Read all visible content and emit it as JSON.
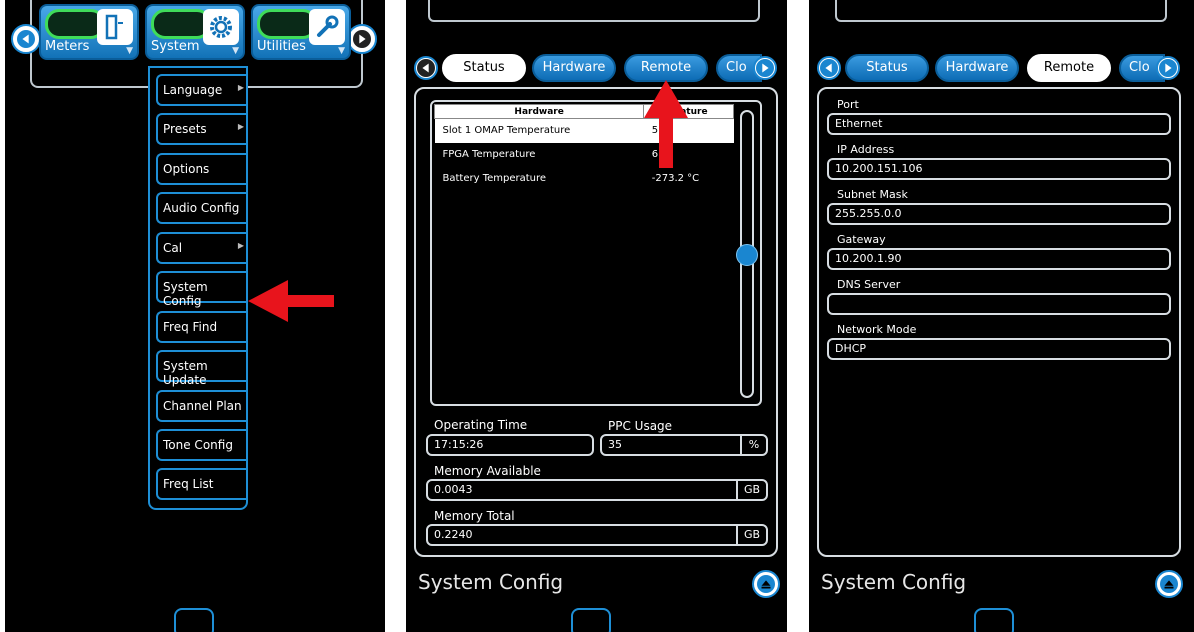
{
  "panel1": {
    "tiles": [
      {
        "label": "Meters",
        "icon": "meter-icon"
      },
      {
        "label": "System",
        "icon": "gear-icon"
      },
      {
        "label": "Utilities",
        "icon": "wrench-icon"
      }
    ],
    "menu": [
      {
        "label": "Language",
        "has_sub": true
      },
      {
        "label": "Presets",
        "has_sub": true
      },
      {
        "label": "Options",
        "has_sub": false
      },
      {
        "label": "Audio Config",
        "has_sub": false
      },
      {
        "label": "Cal",
        "has_sub": true
      },
      {
        "label": "System Config",
        "has_sub": false
      },
      {
        "label": "Freq Find",
        "has_sub": false
      },
      {
        "label": "System Update",
        "has_sub": false
      },
      {
        "label": "Channel Plan",
        "has_sub": false
      },
      {
        "label": "Tone Config",
        "has_sub": false
      },
      {
        "label": "Freq List",
        "has_sub": false
      }
    ],
    "sub_arrow": "▶",
    "menu_arrow": "▼"
  },
  "panel2": {
    "tabs": [
      "Status",
      "Hardware",
      "Remote",
      "Clo"
    ],
    "table": {
      "headers": [
        "Hardware",
        "erature"
      ],
      "rows": [
        [
          "Slot 1 OMAP Temperature",
          "5  °C"
        ],
        [
          "FPGA Temperature",
          "6  °C"
        ],
        [
          "Battery Temperature",
          "-273.2 °C"
        ]
      ]
    },
    "operating_time_label": "Operating Time",
    "operating_time": "17:15:26",
    "ppc_label": "PPC Usage",
    "ppc_value": "35",
    "ppc_unit": "%",
    "mem_avail_label": "Memory Available",
    "mem_avail": "0.0043",
    "mem_avail_unit": "GB",
    "mem_total_label": "Memory Total",
    "mem_total": "0.2240",
    "mem_total_unit": "GB",
    "title": "System Config"
  },
  "panel3": {
    "tabs": [
      "Status",
      "Hardware",
      "Remote",
      "Clo"
    ],
    "fields": [
      {
        "label": "Port",
        "value": "Ethernet"
      },
      {
        "label": "IP Address",
        "value": "10.200.151.106"
      },
      {
        "label": "Subnet Mask",
        "value": "255.255.0.0"
      },
      {
        "label": "Gateway",
        "value": "10.200.1.90"
      },
      {
        "label": "DNS Server",
        "value": ""
      },
      {
        "label": "Network Mode",
        "value": "DHCP"
      }
    ],
    "title": "System Config"
  },
  "colors": {
    "accent": "#1e8fd6",
    "arrow": "#e8141c",
    "frame": "#d7dde2"
  }
}
